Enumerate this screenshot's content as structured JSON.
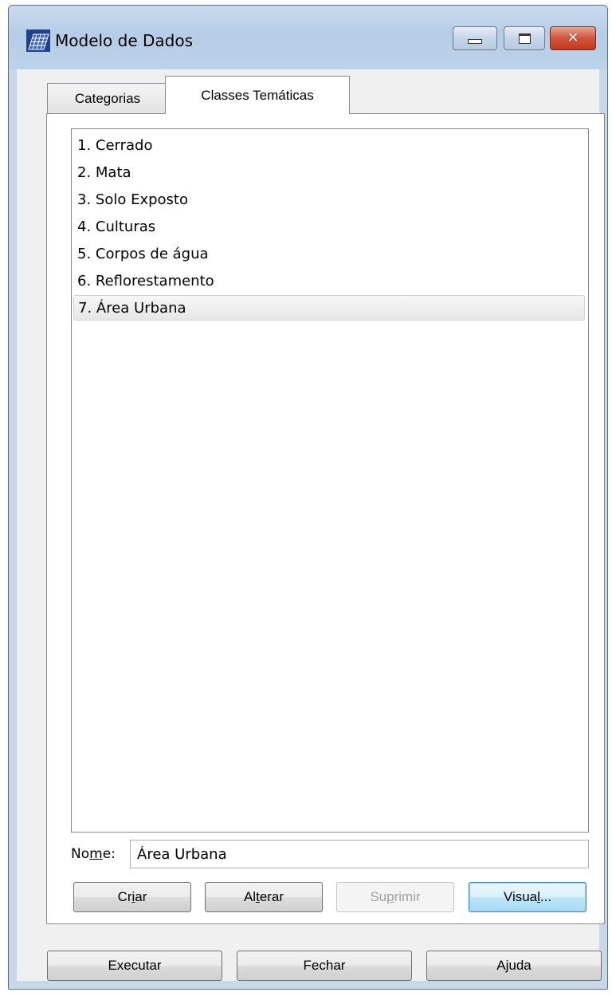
{
  "window": {
    "title": "Modelo de Dados",
    "icon": "grid-map-icon",
    "close_glyph": "✕"
  },
  "tabs": [
    {
      "label": "Categorias",
      "active": false
    },
    {
      "label": "Classes Temáticas",
      "active": true
    }
  ],
  "classes": {
    "items": [
      "1. Cerrado",
      "2. Mata",
      "3. Solo Exposto",
      "4. Culturas",
      "5. Corpos de água",
      "6. Reflorestamento",
      "7. Área Urbana"
    ],
    "selected_index": 6
  },
  "nome": {
    "label_before": "No",
    "label_mnemonic": "m",
    "label_after": "e:",
    "value": "Área Urbana"
  },
  "actions": {
    "criar": {
      "before": "Cr",
      "mnemonic": "i",
      "after": "ar"
    },
    "alterar": {
      "before": "Al",
      "mnemonic": "t",
      "after": "erar"
    },
    "suprimir": {
      "before": "Su",
      "mnemonic": "p",
      "after": "rimir",
      "disabled": true
    },
    "visual": {
      "before": "Visua",
      "mnemonic": "l",
      "after": "..."
    }
  },
  "footer": {
    "executar": "Executar",
    "fechar": "Fechar",
    "ajuda": "Ajuda"
  }
}
